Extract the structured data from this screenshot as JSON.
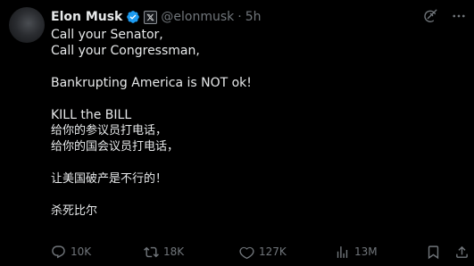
{
  "tweet": {
    "author_name": "Elon Musk",
    "handle": "@elonmusk",
    "separator": "·",
    "time": "5h",
    "lines": [
      "Call your Senator,",
      "Call your Congressman,",
      "",
      "Bankrupting America is NOT ok!",
      "",
      "KILL the BILL",
      "给你的参议员打电话，",
      "给你的国会议员打电话，",
      "",
      "让美国破产是不行的！",
      "",
      "杀死比尔"
    ]
  },
  "actions": {
    "replies": "10K",
    "reposts": "18K",
    "likes": "127K",
    "views": "13M"
  },
  "icons": {
    "verified": "verified-badge-icon",
    "affiliate": "x-affiliate-icon",
    "grok": "grok-icon",
    "more": "more-icon",
    "reply": "reply-icon",
    "repost": "repost-icon",
    "like": "heart-icon",
    "views": "views-icon",
    "share": "share-icon"
  },
  "colors": {
    "verified": "#1d9bf0",
    "muted": "#71767b",
    "text": "#e7e9ea",
    "background": "#000000"
  }
}
